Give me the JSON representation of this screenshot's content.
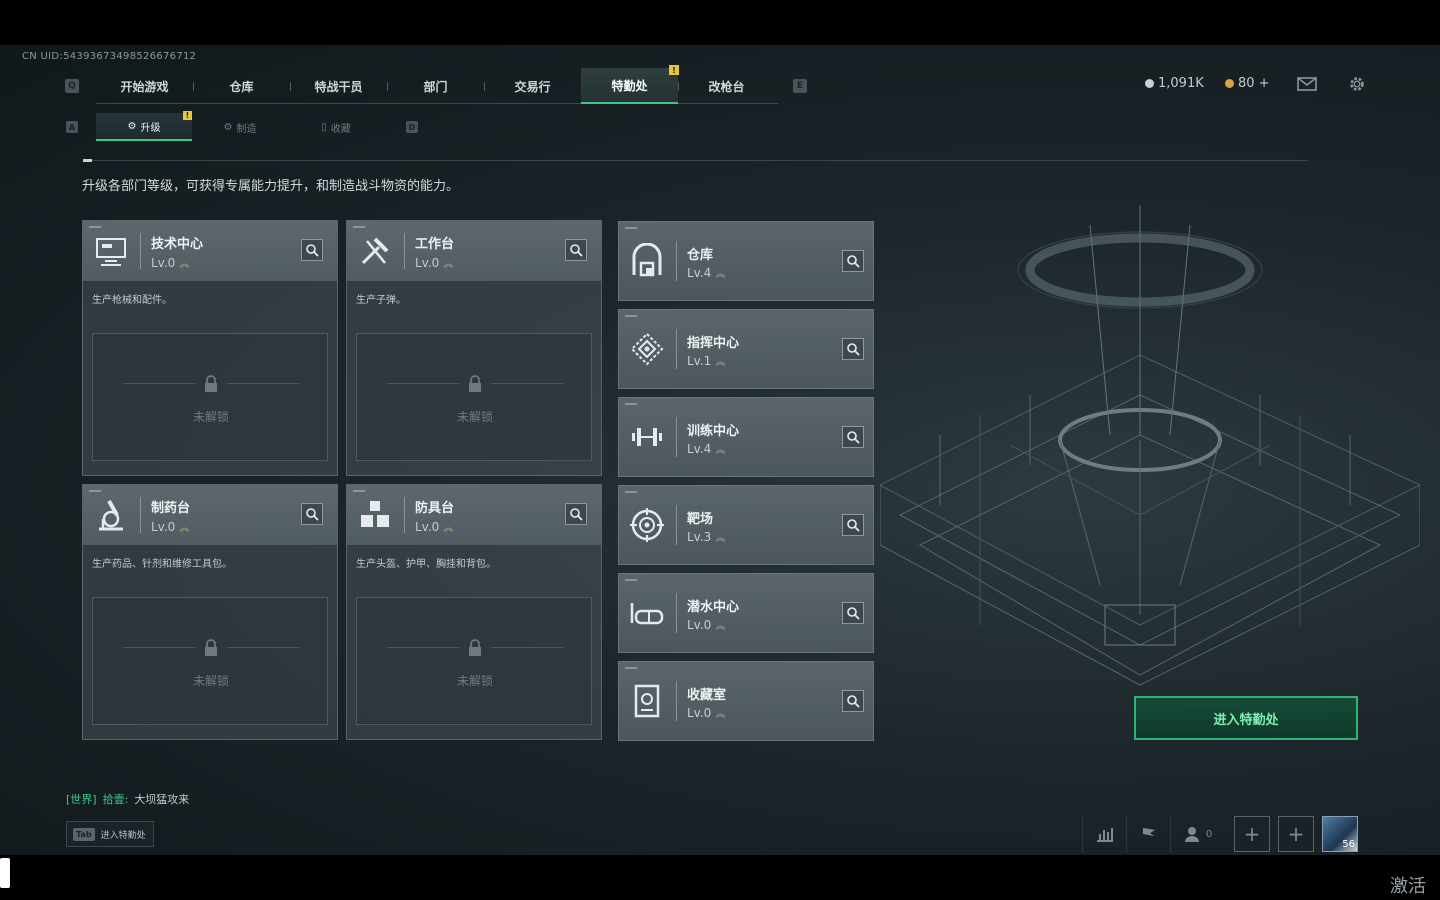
{
  "uid": "CN UID:54393673498526676712",
  "nav": {
    "left_key": "Q",
    "right_key": "E",
    "tabs": [
      {
        "label": "开始游戏",
        "active": false
      },
      {
        "label": "仓库",
        "active": false
      },
      {
        "label": "特战干员",
        "active": false
      },
      {
        "label": "部门",
        "active": false
      },
      {
        "label": "交易行",
        "active": false
      },
      {
        "label": "特勤处",
        "active": true
      },
      {
        "label": "改枪台",
        "active": false
      }
    ]
  },
  "currency": {
    "coins": "1,091K",
    "tickets": "80 +"
  },
  "subnav": {
    "left_key": "A",
    "right_key": "D",
    "tabs": [
      {
        "label": "升级",
        "active": true
      },
      {
        "label": "制造",
        "active": false
      },
      {
        "label": "收藏",
        "active": false
      }
    ]
  },
  "description": "升级各部门等级，可获得专属能力提升，和制造战斗物资的能力。",
  "big_cards": [
    {
      "name": "技术中心",
      "level": "Lv.0",
      "desc": "生产枪械和配件。",
      "locked": "未解锁",
      "icon": "computer-icon"
    },
    {
      "name": "工作台",
      "level": "Lv.0",
      "desc": "生产子弹。",
      "locked": "未解锁",
      "icon": "tools-icon"
    },
    {
      "name": "制药台",
      "level": "Lv.0",
      "desc": "生产药品、针剂和维修工具包。",
      "locked": "未解锁",
      "icon": "microscope-icon"
    },
    {
      "name": "防具台",
      "level": "Lv.0",
      "desc": "生产头盔、护甲、胸挂和背包。",
      "locked": "未解锁",
      "icon": "armor-icon"
    }
  ],
  "small_cards": [
    {
      "name": "仓库",
      "level": "Lv.4",
      "icon": "warehouse-icon"
    },
    {
      "name": "指挥中心",
      "level": "Lv.1",
      "icon": "command-icon"
    },
    {
      "name": "训练中心",
      "level": "Lv.4",
      "icon": "dumbbell-icon"
    },
    {
      "name": "靶场",
      "level": "Lv.3",
      "icon": "target-icon"
    },
    {
      "name": "潜水中心",
      "level": "Lv.0",
      "icon": "diving-mask-icon"
    },
    {
      "name": "收藏室",
      "level": "Lv.0",
      "icon": "collection-icon"
    }
  ],
  "enter_button": "进入特勤处",
  "chat": {
    "channel": "[世界]",
    "user": "拾壹:",
    "message": "大坝猛攻来"
  },
  "tab_hint": {
    "key": "Tab",
    "label": "进入特勤处"
  },
  "bottom_bar": {
    "friends_count": "0",
    "avatar_level": "56"
  },
  "watermark": "激活 W",
  "colors": {
    "accent_green": "#3cc98a",
    "notice_yellow": "#e8c440"
  }
}
